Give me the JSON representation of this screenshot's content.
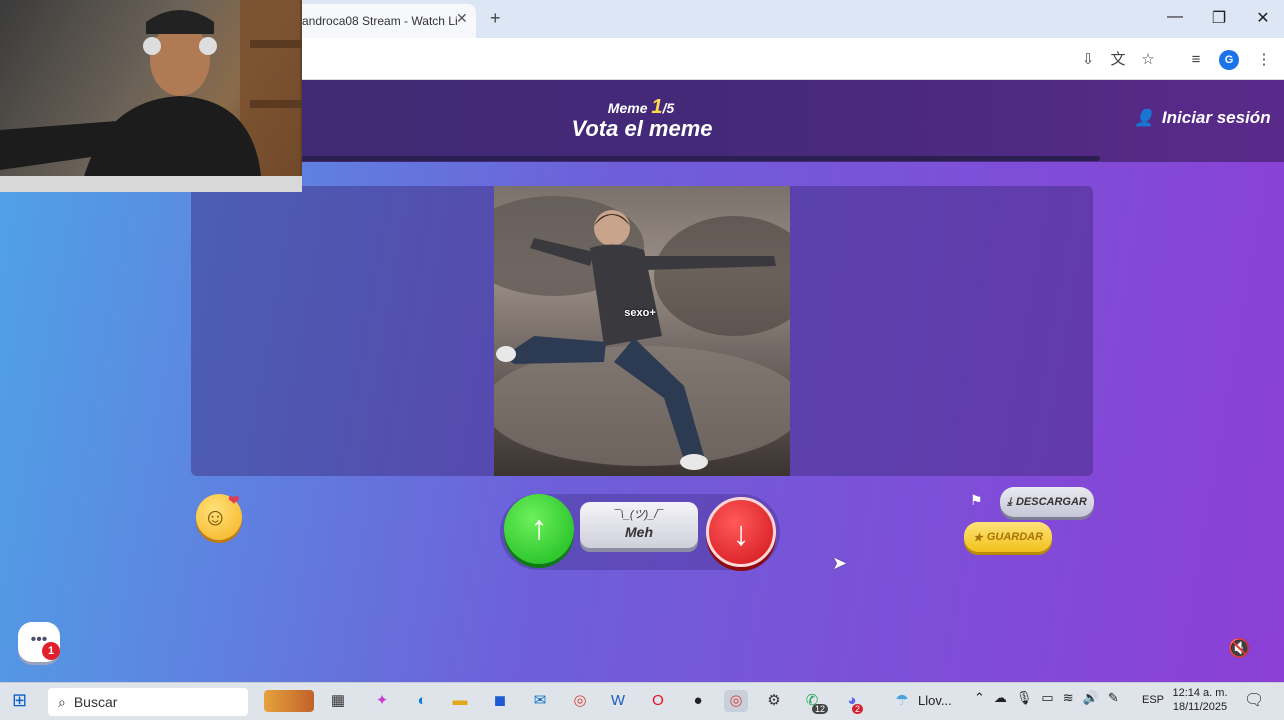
{
  "browser": {
    "tab_title": "androca08 Stream - Watch Li",
    "tab_close": "✕",
    "new_tab": "+",
    "minimize": "—",
    "maximize": "❐",
    "close": "✕",
    "profile_initial": "G"
  },
  "header": {
    "meme_counter_prefix": "Meme ",
    "meme_current": "1",
    "meme_total": "/5",
    "title": "Vota el meme",
    "login_label": "Iniciar sesión"
  },
  "meme": {
    "caption": "sexo+"
  },
  "vote": {
    "up_arrow": "↑",
    "meh_shrug": "¯\\_(ツ)_/¯",
    "meh_label": "Meh",
    "down_arrow": "↓"
  },
  "actions": {
    "download_label": "DESCARGAR",
    "save_label": "GUARDAR"
  },
  "chat": {
    "badge_count": "1"
  },
  "taskbar": {
    "search_label": "Buscar",
    "weather_label": "Llov...",
    "whatsapp_badge": "12",
    "discord_badge": "2",
    "language": "ESP",
    "time": "12:14 a. m.",
    "date": "18/11/2025"
  },
  "colors": {
    "upvote": "#18b81e",
    "downvote": "#d1141b",
    "save": "#f1c21b",
    "meme_counter_accent": "#ffd84a"
  }
}
